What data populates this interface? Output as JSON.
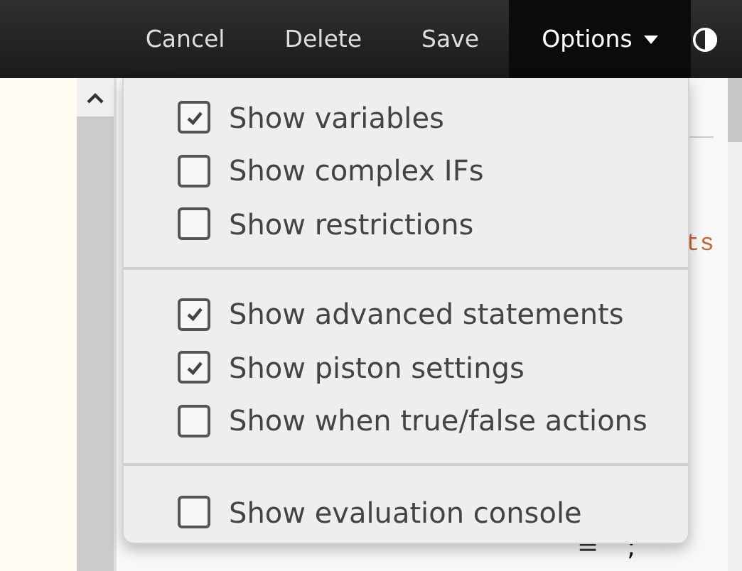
{
  "toolbar": {
    "buttons": [
      {
        "label": "Cancel",
        "selected": false
      },
      {
        "label": "Delete",
        "selected": false
      },
      {
        "label": "Save",
        "selected": false
      },
      {
        "label": "Options",
        "selected": true,
        "dropdown": true
      }
    ]
  },
  "options_menu": {
    "sections": [
      {
        "items": [
          {
            "label": "Show variables",
            "checked": true
          },
          {
            "label": "Show complex IFs",
            "checked": false
          },
          {
            "label": "Show restrictions",
            "checked": false
          }
        ]
      },
      {
        "items": [
          {
            "label": "Show advanced statements",
            "checked": true
          },
          {
            "label": "Show piston settings",
            "checked": true
          },
          {
            "label": "Show when true/false actions",
            "checked": false
          }
        ]
      },
      {
        "items": [
          {
            "label": "Show evaluation console",
            "checked": false
          }
        ]
      }
    ]
  },
  "code": {
    "fragment": "ts",
    "line": [
      {
        "kind": "operator",
        "text": "="
      },
      {
        "kind": "punct",
        "text": ";"
      }
    ]
  }
}
